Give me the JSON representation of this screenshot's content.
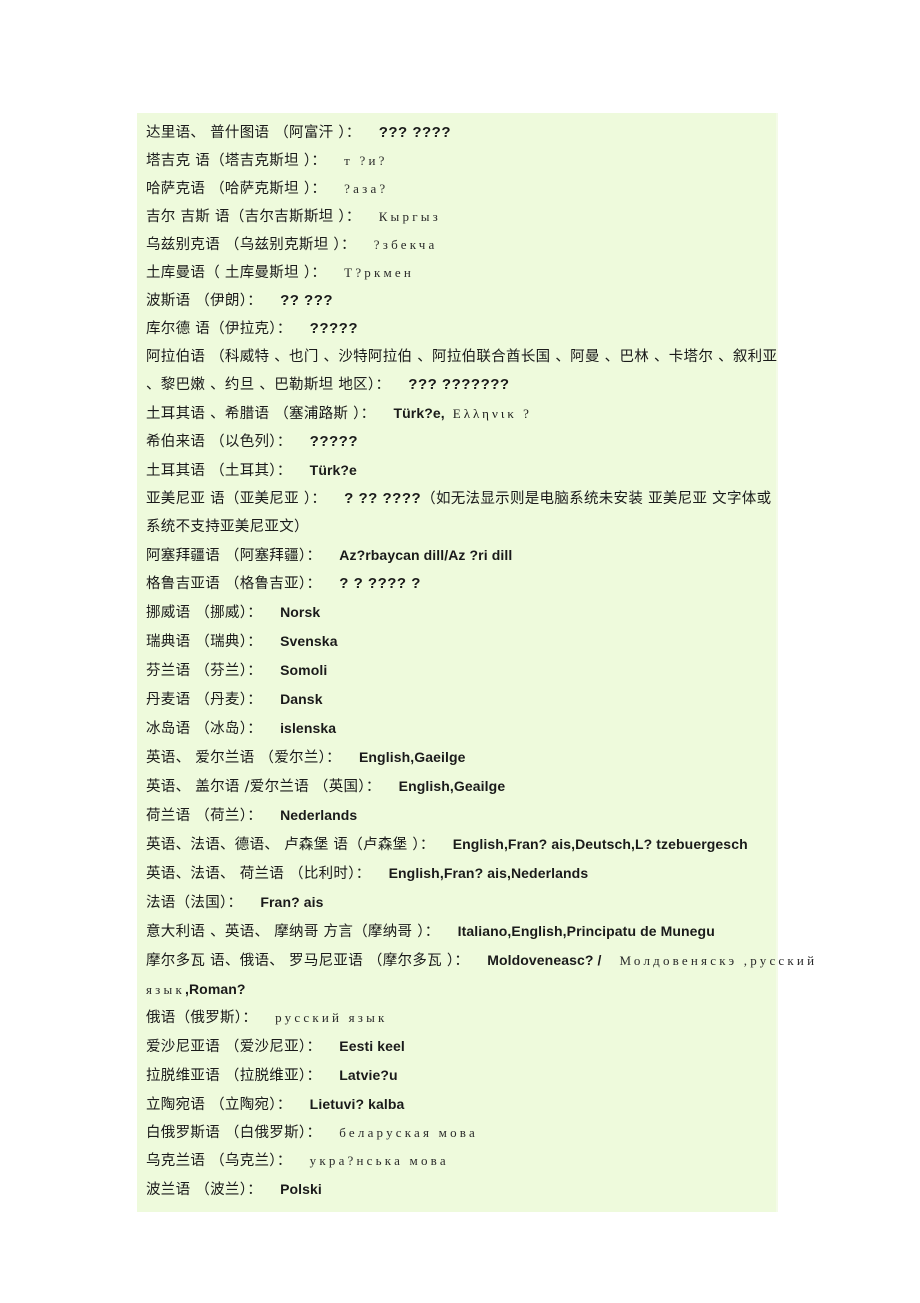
{
  "document": {
    "background_color": "#ffffff",
    "highlight_color": "#eefadc",
    "text_color": "#1a1a1a"
  },
  "lines": [
    {
      "id": "dari-pashto",
      "label": "达里语、 普什图语 （阿富汗 ）：",
      "native": "???  ????",
      "native_script": "qm"
    },
    {
      "id": "tajik",
      "label": "塔吉克 语（塔吉克斯坦 ）：",
      "native": "т ?и?",
      "native_script": "cyr"
    },
    {
      "id": "kazakh",
      "label": "哈萨克语 （哈萨克斯坦 ）：",
      "native": "?аза?",
      "native_script": "cyr"
    },
    {
      "id": "kyrgyz",
      "label": "吉尔 吉斯 语（吉尔吉斯斯坦 ）：",
      "native": "Кыргыз",
      "native_script": "cyr"
    },
    {
      "id": "uzbek",
      "label": "乌兹别克语 （乌兹别克斯坦 ）：",
      "native": "?збекча",
      "native_script": "cyr"
    },
    {
      "id": "turkmen",
      "label": "土库曼语（ 土库曼斯坦 ）：",
      "native": "Т?ркмен",
      "native_script": "cyr"
    },
    {
      "id": "persian",
      "label": "波斯语 （伊朗）：",
      "native": "?? ???",
      "native_script": "qm"
    },
    {
      "id": "kurdish",
      "label": "库尔德 语（伊拉克）：",
      "native": "?????",
      "native_script": "qm"
    },
    {
      "id": "arabic",
      "label": "阿拉伯语 （科威特 、也门 、沙特阿拉伯 、阿拉伯联合酋长国  、阿曼 、巴林 、卡塔尔 、叙利亚 、黎巴嫩 、约旦 、巴勒斯坦 地区）：",
      "native": "??? ???????",
      "native_script": "qm",
      "wrap": true
    },
    {
      "id": "turkish-greek-cyprus",
      "label": "土耳其语 、希腊语 （塞浦路斯 ）：",
      "native": "Türk?e,",
      "native_script": "latin",
      "extra_greek": "Ελληνικ ?"
    },
    {
      "id": "hebrew",
      "label": "希伯来语 （以色列）：",
      "native": "?????",
      "native_script": "qm"
    },
    {
      "id": "turkish",
      "label": "土耳其语 （土耳其）：",
      "native": "Türk?e",
      "native_script": "latin"
    },
    {
      "id": "armenian",
      "label": "亚美尼亚 语（亚美尼亚 ）：",
      "native": "? ?? ????",
      "native_script": "qm",
      "note": "（如无法显示则是电脑系统未安装  亚美尼亚 文字体或系统不支持亚美尼亚文）",
      "wrap": true
    },
    {
      "id": "azerbaijani",
      "label": "阿塞拜疆语 （阿塞拜疆）：",
      "native": "Az?rbaycan dill/Az  ?ri dill",
      "native_script": "latin"
    },
    {
      "id": "georgian",
      "label": "格鲁吉亚语 （格鲁吉亚）：",
      "native": "? ? ????   ?",
      "native_script": "qm"
    },
    {
      "id": "norwegian",
      "label": "挪威语 （挪威）：",
      "native": "Norsk",
      "native_script": "latin"
    },
    {
      "id": "swedish",
      "label": "瑞典语 （瑞典）：",
      "native": "Svenska",
      "native_script": "latin"
    },
    {
      "id": "finnish",
      "label": "芬兰语 （芬兰）：",
      "native": "Somoli",
      "native_script": "latin"
    },
    {
      "id": "danish",
      "label": "丹麦语 （丹麦）：",
      "native": "Dansk",
      "native_script": "latin"
    },
    {
      "id": "icelandic",
      "label": "冰岛语 （冰岛）：",
      "native": "islenska",
      "native_script": "latin"
    },
    {
      "id": "english-irish-ireland",
      "label": "英语、 爱尔兰语 （爱尔兰）：",
      "native": "English,Gaeilge",
      "native_script": "latin"
    },
    {
      "id": "english-gaelic-uk",
      "label": "英语、 盖尔语 /爱尔兰语 （英国）：",
      "native": "English,Geailge",
      "native_script": "latin"
    },
    {
      "id": "dutch",
      "label": "荷兰语 （荷兰）：",
      "native": "Nederlands",
      "native_script": "latin"
    },
    {
      "id": "luxembourg",
      "label": "英语、法语、德语、  卢森堡 语（卢森堡 ）：",
      "native": "English,Fran?  ais,Deutsch,L?  tzebuergesch",
      "native_script": "latin"
    },
    {
      "id": "belgium",
      "label": "英语、法语、 荷兰语 （比利时）：",
      "native": "English,Fran?  ais,Nederlands",
      "native_script": "latin"
    },
    {
      "id": "french",
      "label": "法语（法国）：",
      "native": "Fran? ais",
      "native_script": "latin"
    },
    {
      "id": "monaco",
      "label": "意大利语 、英语、 摩纳哥 方言（摩纳哥 ）：",
      "native": "Italiano,English,Principatu de Munegu",
      "native_script": "latin"
    },
    {
      "id": "moldovan",
      "label": "摩尔多瓦 语、俄语、 罗马尼亚语 （摩尔多瓦 ）：",
      "native": "Moldoveneasc? /",
      "native_script": "latin",
      "cyrillic_tail": "Молдовеняскэ ,русский",
      "continuation_cyr": "язык",
      "continuation_latin": ",Roman?",
      "overflow": true
    },
    {
      "id": "russian",
      "label": "俄语（俄罗斯）：",
      "native": "русский  язык",
      "native_script": "cyr"
    },
    {
      "id": "estonian",
      "label": "爱沙尼亚语 （爱沙尼亚）：",
      "native": "Eesti keel",
      "native_script": "latin"
    },
    {
      "id": "latvian",
      "label": "拉脱维亚语 （拉脱维亚）：",
      "native": "Latvie?u",
      "native_script": "latin"
    },
    {
      "id": "lithuanian",
      "label": "立陶宛语 （立陶宛）：",
      "native": "Lietuvi? kalba",
      "native_script": "latin"
    },
    {
      "id": "belarusian",
      "label": "白俄罗斯语 （白俄罗斯）：",
      "native": "беларуская  мова",
      "native_script": "cyr"
    },
    {
      "id": "ukrainian",
      "label": "乌克兰语 （乌克兰）：",
      "native": "укра?нська  мова",
      "native_script": "cyr"
    },
    {
      "id": "polish",
      "label": "波兰语 （波兰）：",
      "native": "Polski",
      "native_script": "latin"
    }
  ]
}
